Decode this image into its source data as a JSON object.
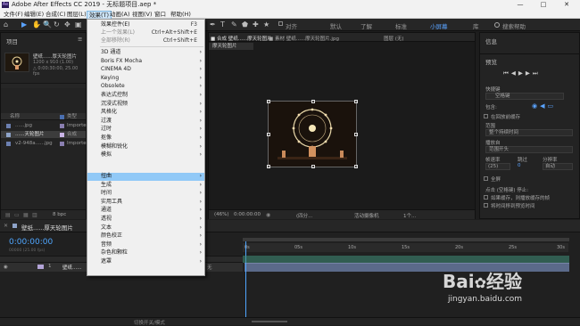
{
  "titlebar": {
    "title": "Adobe After Effects CC 2019 - 无标题项目.aep *",
    "app_icon": "Ae",
    "minimize": "—",
    "maximize": "□",
    "close": "✕"
  },
  "menubar": {
    "items": [
      "文件(F)",
      "编辑(E)",
      "合成(C)",
      "图层(L)",
      "效果(T)",
      "动画(A)",
      "视图(V)",
      "窗口",
      "帮助(H)"
    ]
  },
  "toolbar": {
    "tools": [
      "⌂",
      "▶",
      "✋",
      "🔍",
      "↻",
      "✥",
      "▣",
      "✒",
      "T",
      "✎",
      "⬟",
      "✚",
      "★"
    ],
    "snap_label": "对齐",
    "workspaces": [
      "默认",
      "了解",
      "标准",
      "小屏幕",
      "库"
    ],
    "active_workspace": "小屏幕",
    "search_placeholder": "搜索帮助"
  },
  "project": {
    "title": "项目",
    "menu_icon": "≡",
    "comp_name": "壁纸......厚天轮图片",
    "comp_size": "1200 x 910 (1.00)",
    "comp_duration": "△ 0:00:30:00, 25.00 fps",
    "col_name": "名称",
    "col_type": "类型",
    "rows": [
      {
        "name": "......jpg",
        "type": "Importe"
      },
      {
        "name": "......天轮图片",
        "type": "合成"
      },
      {
        "name": "v2-948a......jpg",
        "type": "Importe"
      }
    ],
    "bpc": "8 bpc"
  },
  "comp_panel": {
    "tabs": [
      "■ 合成 壁纸......摩天轮图片",
      "■ 素材 壁纸......摩天轮图片.jpg",
      "图层 (无)"
    ],
    "subtab": "摩天轮图片",
    "zoom": "(46%)",
    "timecode": "0:00:00:00",
    "resolution": "(四分...",
    "camera": "活动摄像机",
    "views": "1个..."
  },
  "info": {
    "tab_info": "信息",
    "tab_preview": "预览",
    "shortcut_label": "快捷键",
    "shortcut_value": "空格键",
    "include_label": "包含:",
    "cache_label": "在回放前缓存",
    "range_label": "范围",
    "range_value": "整个持续时间",
    "play_from_label": "播放自",
    "play_from_value": "范围开头",
    "frame_rate_label": "帧速率",
    "skip_label": "跳过",
    "resolution_label": "分辨率",
    "frame_rate_value": "(25)",
    "skip_value": "0",
    "resolution_value": "自动",
    "fullscreen_label": "全屏",
    "stop_note": "点击 (空格键) 停止:",
    "cached_note": "如果缓存，则播放缓存的帧",
    "move_time_note": "将时间移到预览时间"
  },
  "timeline": {
    "tab": "壁纸......厚天轮图片",
    "timecode": "0:00:00:00",
    "fps_note": "00000 (25.00 fps)",
    "layer_number": "1",
    "layer_name": "壁纸......",
    "parent_label": "无",
    "ruler_ticks": [
      "0s",
      "05s",
      "10s",
      "15s",
      "20s",
      "25s",
      "30s"
    ],
    "switch_label": "切换开关/模式"
  },
  "effects_menu": {
    "items": [
      {
        "label": "效果控件(E)",
        "shortcut": "F3",
        "disabled": false,
        "submenu": false
      },
      {
        "label": "上一个效果(L)",
        "shortcut": "Ctrl+Alt+Shift+E",
        "disabled": true,
        "submenu": false
      },
      {
        "label": "全部移除(R)",
        "shortcut": "Ctrl+Shift+E",
        "disabled": true,
        "submenu": false
      },
      {
        "label": "3D 通道",
        "submenu": true
      },
      {
        "label": "Boris FX Mocha",
        "submenu": true
      },
      {
        "label": "CINEMA 4D",
        "submenu": true
      },
      {
        "label": "Keying",
        "submenu": true
      },
      {
        "label": "Obsolete",
        "submenu": true
      },
      {
        "label": "表达式控制",
        "submenu": true
      },
      {
        "label": "沉浸式视频",
        "submenu": true
      },
      {
        "label": "风格化",
        "submenu": true
      },
      {
        "label": "过渡",
        "submenu": true
      },
      {
        "label": "过时",
        "submenu": true
      },
      {
        "label": "抠像",
        "submenu": true
      },
      {
        "label": "模糊和锐化",
        "submenu": true
      },
      {
        "label": "模拟",
        "submenu": true
      },
      {
        "label": "扭曲",
        "submenu": true,
        "selected": true
      },
      {
        "label": "生成",
        "submenu": true
      },
      {
        "label": "时间",
        "submenu": true
      },
      {
        "label": "实用工具",
        "submenu": true
      },
      {
        "label": "通道",
        "submenu": true
      },
      {
        "label": "透视",
        "submenu": true
      },
      {
        "label": "文本",
        "submenu": true
      },
      {
        "label": "颜色校正",
        "submenu": true
      },
      {
        "label": "音频",
        "submenu": true
      },
      {
        "label": "杂色和颗粒",
        "submenu": true
      },
      {
        "label": "遮罩",
        "submenu": true
      }
    ]
  },
  "watermark": {
    "brand": "Bai",
    "brand2": "经验",
    "url": "jingyan.baidu.com"
  }
}
